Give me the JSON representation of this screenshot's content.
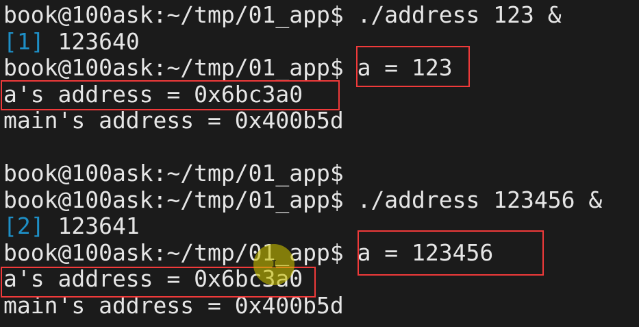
{
  "terminal": {
    "lines": [
      {
        "prompt": "book@100ask:~/tmp/01_app$",
        "text": " ./address 123 &"
      },
      {
        "job": "[1]",
        "text": " 123640"
      },
      {
        "prompt": "book@100ask:~/tmp/01_app$",
        "text": " a = 123"
      },
      {
        "text": "a's address = 0x6bc3a0"
      },
      {
        "text": "main's address = 0x400b5d"
      },
      {
        "text": ""
      },
      {
        "prompt": "book@100ask:~/tmp/01_app$",
        "text": ""
      },
      {
        "prompt": "book@100ask:~/tmp/01_app$",
        "text": " ./address 123456 &"
      },
      {
        "job": "[2]",
        "text": " 123641"
      },
      {
        "prompt": "book@100ask:~/tmp/01_app$",
        "text": " a = 123456"
      },
      {
        "text": "a's address = 0x6bc3a0"
      },
      {
        "text": "main's address = 0x400b5d"
      }
    ]
  },
  "colors": {
    "background": "#1b1b1b",
    "text": "#e6e6e6",
    "job_number": "#1e8fc6",
    "highlight_box": "#f03a3a"
  }
}
